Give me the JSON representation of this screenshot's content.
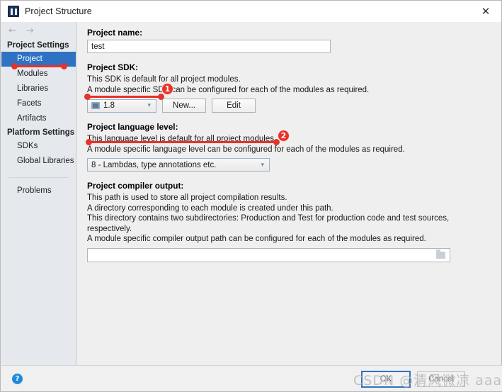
{
  "window": {
    "title": "Project Structure",
    "app_icon": "intellij-idea-icon",
    "close_icon": "close-icon"
  },
  "nav": {
    "back_icon": "arrow-left-icon",
    "forward_icon": "arrow-right-icon"
  },
  "sidebar": {
    "groups": [
      {
        "title": "Project Settings",
        "items": [
          {
            "label": "Project",
            "selected": true
          },
          {
            "label": "Modules",
            "selected": false
          },
          {
            "label": "Libraries",
            "selected": false
          },
          {
            "label": "Facets",
            "selected": false
          },
          {
            "label": "Artifacts",
            "selected": false
          }
        ]
      },
      {
        "title": "Platform Settings",
        "items": [
          {
            "label": "SDKs",
            "selected": false
          },
          {
            "label": "Global Libraries",
            "selected": false
          }
        ]
      }
    ],
    "problems": "Problems"
  },
  "main": {
    "project_name": {
      "label": "Project name:",
      "value": "test",
      "placeholder": ""
    },
    "project_sdk": {
      "label": "Project SDK:",
      "desc_1": "This SDK is default for all project modules.",
      "desc_2": "A module specific SDK can be configured for each of the modules as required.",
      "selected": "1.8",
      "sdk_icon": "sdk-module-icon",
      "caret_icon": "chevron-down-icon",
      "new_button": "New...",
      "edit_button": "Edit"
    },
    "language_level": {
      "label": "Project language level:",
      "desc_1": "This language level is default for all project modules.",
      "desc_2": "A module specific language level can be configured for each of the modules as required.",
      "selected": "8 - Lambdas, type annotations etc.",
      "caret_icon": "chevron-down-icon"
    },
    "compiler_output": {
      "label": "Project compiler output:",
      "desc_1": "This path is used to store all project compilation results.",
      "desc_2": "A directory corresponding to each module is created under this path.",
      "desc_3": "This directory contains two subdirectories: Production and Test for production code and test sources, respectively.",
      "desc_4": "A module specific compiler output path can be configured for each of the modules as required.",
      "value": "",
      "placeholder": "",
      "browse_icon": "folder-icon"
    }
  },
  "footer": {
    "help_icon": "help-question-icon",
    "help_glyph": "?",
    "ok_button": "OK",
    "cancel_button": "Cancel"
  },
  "annotations": {
    "badge_1": "1",
    "badge_2": "2"
  },
  "watermark": {
    "text": "CSDN @清风微凉 aaa"
  },
  "colors": {
    "accent_selection": "#2f72c4",
    "annotation_red": "#e8312a",
    "sidebar_bg": "#e5e9ed",
    "main_bg": "#efefef",
    "help_blue": "#1e8bd8"
  }
}
